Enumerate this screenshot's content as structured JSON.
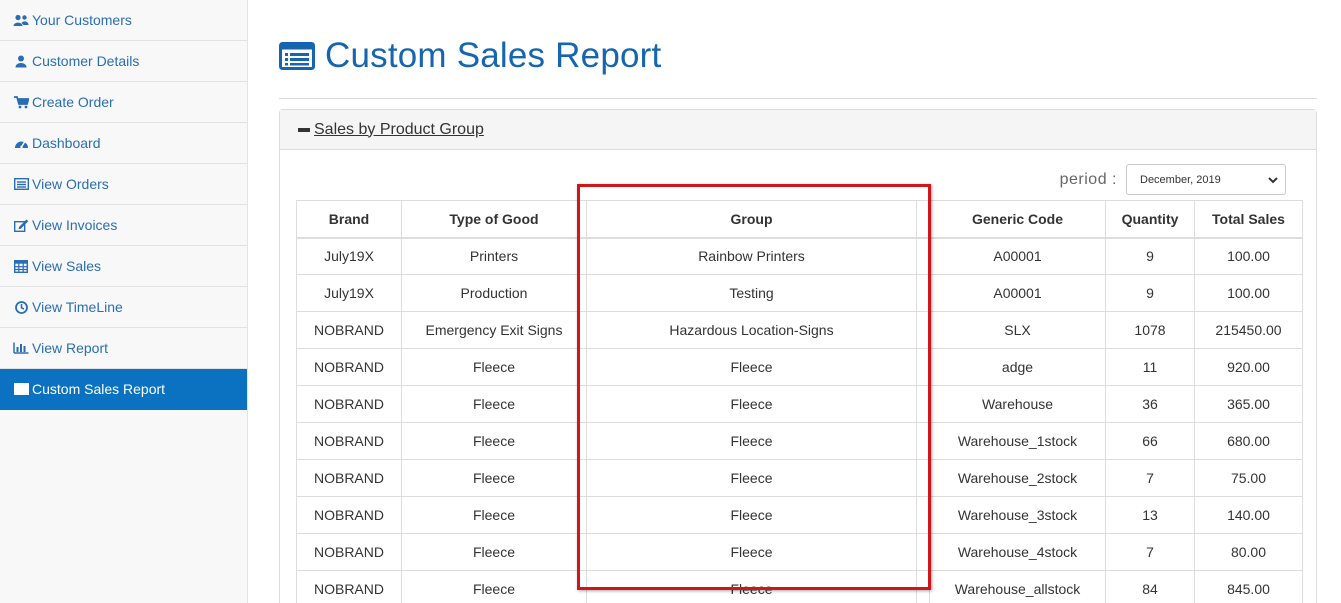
{
  "sidebar": {
    "items": [
      {
        "label": "Your Customers",
        "icon": "users-icon"
      },
      {
        "label": "Customer Details",
        "icon": "user-icon"
      },
      {
        "label": "Create Order",
        "icon": "cart-icon"
      },
      {
        "label": "Dashboard",
        "icon": "dashboard-icon"
      },
      {
        "label": "View Orders",
        "icon": "list-icon"
      },
      {
        "label": "View Invoices",
        "icon": "edit-icon"
      },
      {
        "label": "View Sales",
        "icon": "table-icon"
      },
      {
        "label": "View TimeLine",
        "icon": "clock-icon"
      },
      {
        "label": "View Report",
        "icon": "bar-chart-icon"
      },
      {
        "label": "Custom Sales Report",
        "icon": "list-icon",
        "active": true
      }
    ]
  },
  "page": {
    "title": "Custom Sales Report"
  },
  "panel": {
    "heading": " Sales by Product Group",
    "period_label": "period :",
    "period_value": "December, 2019"
  },
  "table": {
    "headers": [
      "Brand",
      "Type of Good",
      "Group",
      "",
      "Generic Code",
      "Quantity",
      "Total Sales"
    ],
    "rows": [
      [
        "July19X",
        "Printers",
        "Rainbow Printers",
        "",
        "A00001",
        "9",
        "100.00"
      ],
      [
        "July19X",
        "Production",
        "Testing",
        "",
        "A00001",
        "9",
        "100.00"
      ],
      [
        "NOBRAND",
        "Emergency Exit Signs",
        "Hazardous Location-Signs",
        "",
        "SLX",
        "1078",
        "215450.00"
      ],
      [
        "NOBRAND",
        "Fleece",
        "Fleece",
        "",
        "adge",
        "11",
        "920.00"
      ],
      [
        "NOBRAND",
        "Fleece",
        "Fleece",
        "",
        "Warehouse",
        "36",
        "365.00"
      ],
      [
        "NOBRAND",
        "Fleece",
        "Fleece",
        "",
        "Warehouse_1stock",
        "66",
        "680.00"
      ],
      [
        "NOBRAND",
        "Fleece",
        "Fleece",
        "",
        "Warehouse_2stock",
        "7",
        "75.00"
      ],
      [
        "NOBRAND",
        "Fleece",
        "Fleece",
        "",
        "Warehouse_3stock",
        "13",
        "140.00"
      ],
      [
        "NOBRAND",
        "Fleece",
        "Fleece",
        "",
        "Warehouse_4stock",
        "7",
        "80.00"
      ],
      [
        "NOBRAND",
        "Fleece",
        "Fleece",
        "",
        "Warehouse_allstock",
        "84",
        "845.00"
      ]
    ]
  },
  "colors": {
    "accent": "#0b72c2",
    "title": "#1565b0",
    "sidebar_link": "#2a6db5",
    "highlight_box": "#d0161b"
  }
}
